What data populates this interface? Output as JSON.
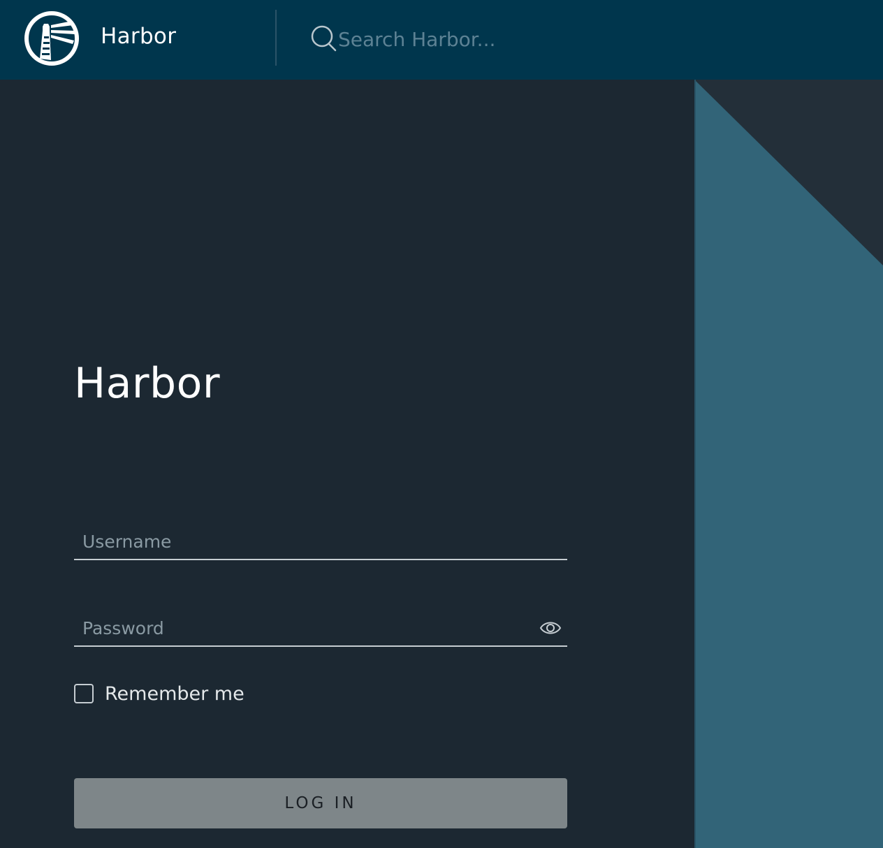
{
  "header": {
    "brand_name": "Harbor",
    "search_placeholder": "Search Harbor...",
    "logo_icon": "harbor-lighthouse-icon",
    "search_icon": "search-icon"
  },
  "login": {
    "title": "Harbor",
    "username_placeholder": "Username",
    "password_placeholder": "Password",
    "show_password_icon": "eye-icon",
    "remember_label": "Remember me",
    "remember_checked": false,
    "login_button_label": "LOG IN"
  },
  "colors": {
    "header_bg": "#00364d",
    "page_bg": "#1c2832",
    "side_dark": "#232f39",
    "side_accent": "#326478",
    "button_bg": "#7e8689"
  }
}
